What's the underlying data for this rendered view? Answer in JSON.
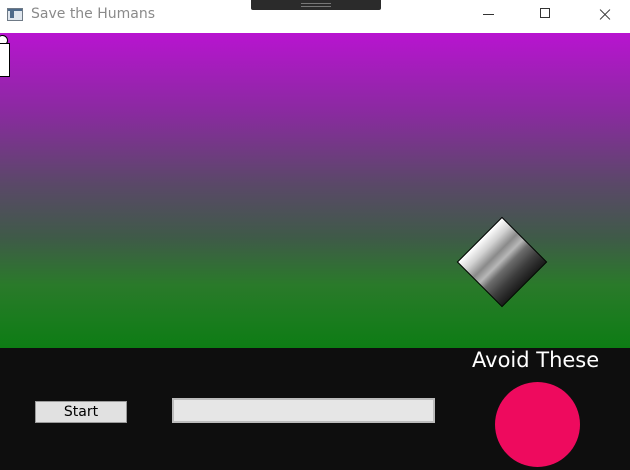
{
  "window": {
    "title": "Save the Humans"
  },
  "play_area": {
    "gradient_top": "#b814d0",
    "gradient_bottom": "#0d7d14"
  },
  "controls": {
    "start_label": "Start",
    "progress": 0
  },
  "legend": {
    "avoid_label": "Avoid These",
    "enemy_color": "#ee0a5e"
  },
  "icons": {
    "app": "app-window-icon",
    "minimize": "minimize-icon",
    "maximize": "maximize-icon",
    "close": "close-icon"
  }
}
